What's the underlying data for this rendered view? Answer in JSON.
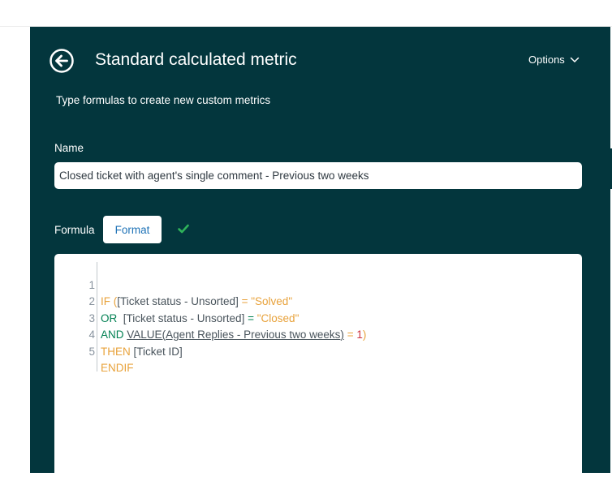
{
  "header": {
    "title": "Standard calculated metric",
    "subtitle": "Type formulas to create new custom metrics",
    "options_label": "Options"
  },
  "form": {
    "name_label": "Name",
    "name_value": "Closed ticket with agent's single comment - Previous two weeks",
    "formula_label": "Formula",
    "format_button": "Format"
  },
  "editor": {
    "line_numbers": [
      "1",
      "2",
      "3",
      "4",
      "5"
    ],
    "line1": {
      "kw_if": "IF",
      "paren_open": "(",
      "field": "[Ticket status - Unsorted]",
      "op": "=",
      "value": "\"Solved\""
    },
    "line2": {
      "kw_or": "OR",
      "field": "[Ticket status - Unsorted]",
      "op": "=",
      "value": "\"Closed\""
    },
    "line3": {
      "kw_and": "AND",
      "fn": "VALUE",
      "paren_open": "(",
      "field": "Agent Replies - Previous two weeks",
      "paren_close": ")",
      "op": "=",
      "num": "1",
      "paren_close2": ")"
    },
    "line4": {
      "kw_then": "THEN",
      "field": "[Ticket ID]"
    },
    "line5": {
      "kw_endif": "ENDIF"
    }
  },
  "colors": {
    "panel_bg": "#03363d",
    "keyword_orange": "#e8a23b",
    "keyword_green": "#038153",
    "number_red": "#cc3340",
    "check_green": "#2fb35a"
  },
  "icons": {
    "back": "arrow-left-circle-icon",
    "options": "chevron-down-icon",
    "valid": "checkmark-icon"
  }
}
